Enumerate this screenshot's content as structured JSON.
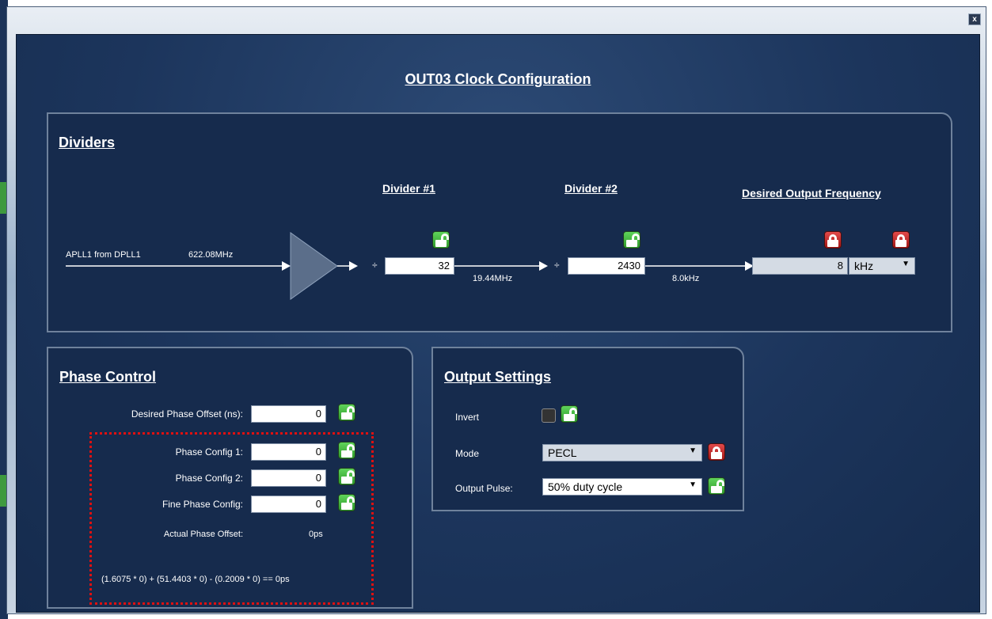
{
  "window": {
    "close_label": "x"
  },
  "title": "OUT03 Clock Configuration",
  "dividers": {
    "title": "Dividers",
    "source_label": "APLL1 from DPLL1",
    "source_freq": "622.08MHz",
    "divide_symbol": "÷",
    "divider1": {
      "header": "Divider #1",
      "value": "32",
      "output_freq": "19.44MHz",
      "lock": "unlocked"
    },
    "divider2": {
      "header": "Divider #2",
      "value": "2430",
      "output_freq": "8.0kHz",
      "lock": "unlocked"
    },
    "desired": {
      "header": "Desired Output Frequency",
      "value": "8",
      "unit": "kHz",
      "value_lock": "locked",
      "unit_lock": "locked"
    }
  },
  "phase": {
    "title": "Phase Control",
    "desired_offset_label": "Desired Phase Offset (ns):",
    "desired_offset_value": "0",
    "config1_label": "Phase Config 1:",
    "config1_value": "0",
    "config2_label": "Phase Config 2:",
    "config2_value": "0",
    "fine_label": "Fine Phase Config:",
    "fine_value": "0",
    "actual_label": "Actual Phase Offset:",
    "actual_value": "0ps",
    "formula": "(1.6075 * 0) + (51.4403 * 0) - (0.2009 * 0) == 0ps"
  },
  "output": {
    "title": "Output Settings",
    "invert_label": "Invert",
    "mode_label": "Mode",
    "mode_value": "PECL",
    "pulse_label": "Output Pulse:",
    "pulse_value": "50% duty cycle"
  },
  "icons": {
    "unlocked": "lock-open-icon",
    "locked": "lock-closed-icon"
  },
  "colors": {
    "background": "#1c355c",
    "unlock_green": "#3fb83a",
    "lock_red": "#c62828",
    "highlight_dotted": "#e01010"
  }
}
